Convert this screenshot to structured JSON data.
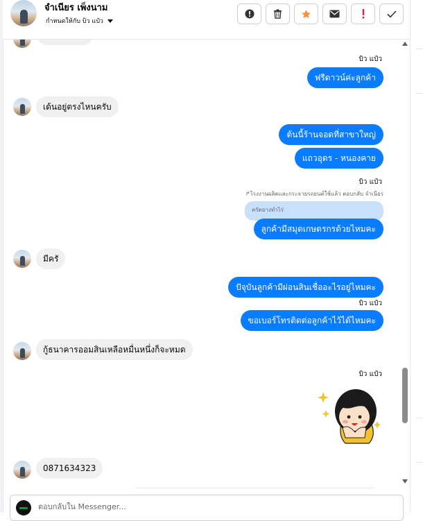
{
  "header": {
    "contact_name": "จำเนียร เพ็งนาม",
    "assign_label": "กำหนดให้กับ บิว แป๋ว",
    "actions": [
      {
        "name": "mark-spam-button",
        "icon": "exclamation-circle-icon"
      },
      {
        "name": "delete-button",
        "icon": "trash-icon"
      },
      {
        "name": "star-button",
        "icon": "star-icon"
      },
      {
        "name": "mark-unread-button",
        "icon": "envelope-icon"
      },
      {
        "name": "follow-up-button",
        "icon": "exclamation-icon"
      },
      {
        "name": "mark-done-button",
        "icon": "check-icon"
      }
    ],
    "star_color": "#f7923b",
    "followup_color": "#e41e3f"
  },
  "messages": {
    "sender_name": "บิว แป๋ว",
    "out_1": "ฟรีดาวน์ค่ะลูกค้า",
    "in_1": "เด้นอยู่ตรงไหนครับ",
    "out_2": "ต้นนี้ร้านจอดที่สาขาใหญ่",
    "out_3": "แถวอุดร -  หนองคาย",
    "reply_meta": "↱โรงงานผลิตและกระจายรถยนต์ใช้แล้ว ตอบกลับ จำเนียร",
    "quote_text": "ครัดยางทำไร่",
    "out_4": "ลูกค้ามีสมุดเกษตรกรด้วยไหมคะ",
    "in_2": "มีครั",
    "out_5": "ปัจุบันลูกค้ามีผ่อนสินเชื่ออะไรอยู่ไหมคะ",
    "out_6": "ขอเบอร์โทรติดต่อลูกค้าไว้ได้ไหมคะ",
    "in_3": "กู้ธนาคารออมสินเหลือหมื่นหนึ่งก็จะหมด",
    "in_4": "0871634323",
    "sticker_icon": "smiling-girl-sticker-icon"
  },
  "composer": {
    "placeholder": "ตอบกลับใน Messenger..."
  },
  "colors": {
    "outgoing_bubble": "#0a7cff",
    "incoming_bubble": "#f0f0f0"
  }
}
